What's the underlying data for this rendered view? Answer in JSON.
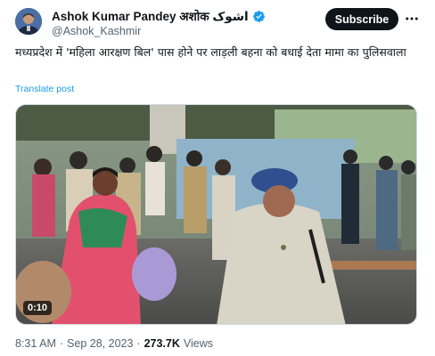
{
  "author": {
    "display_name": "Ashok Kumar Pandey अशोक اشوک",
    "handle": "@Ashok_Kashmir",
    "verified_icon": "verified-badge-icon"
  },
  "actions": {
    "subscribe_label": "Subscribe",
    "more_icon": "more-options-icon"
  },
  "tweet": {
    "text": "मध्यप्रदेश में 'महिला आरक्षण बिल' पास होने पर लाड़ली बहना को बधाई देता मामा का पुलिसवाला",
    "translate_label": "Translate post"
  },
  "media": {
    "duration": "0:10"
  },
  "meta": {
    "time": "8:31 AM",
    "separator1": "·",
    "date": "Sep 28, 2023",
    "separator2": "·",
    "views_count": "273.7K",
    "views_label": "Views"
  },
  "colors": {
    "accent": "#1d9bf0",
    "text_primary": "#0f1419",
    "text_secondary": "#536471"
  }
}
